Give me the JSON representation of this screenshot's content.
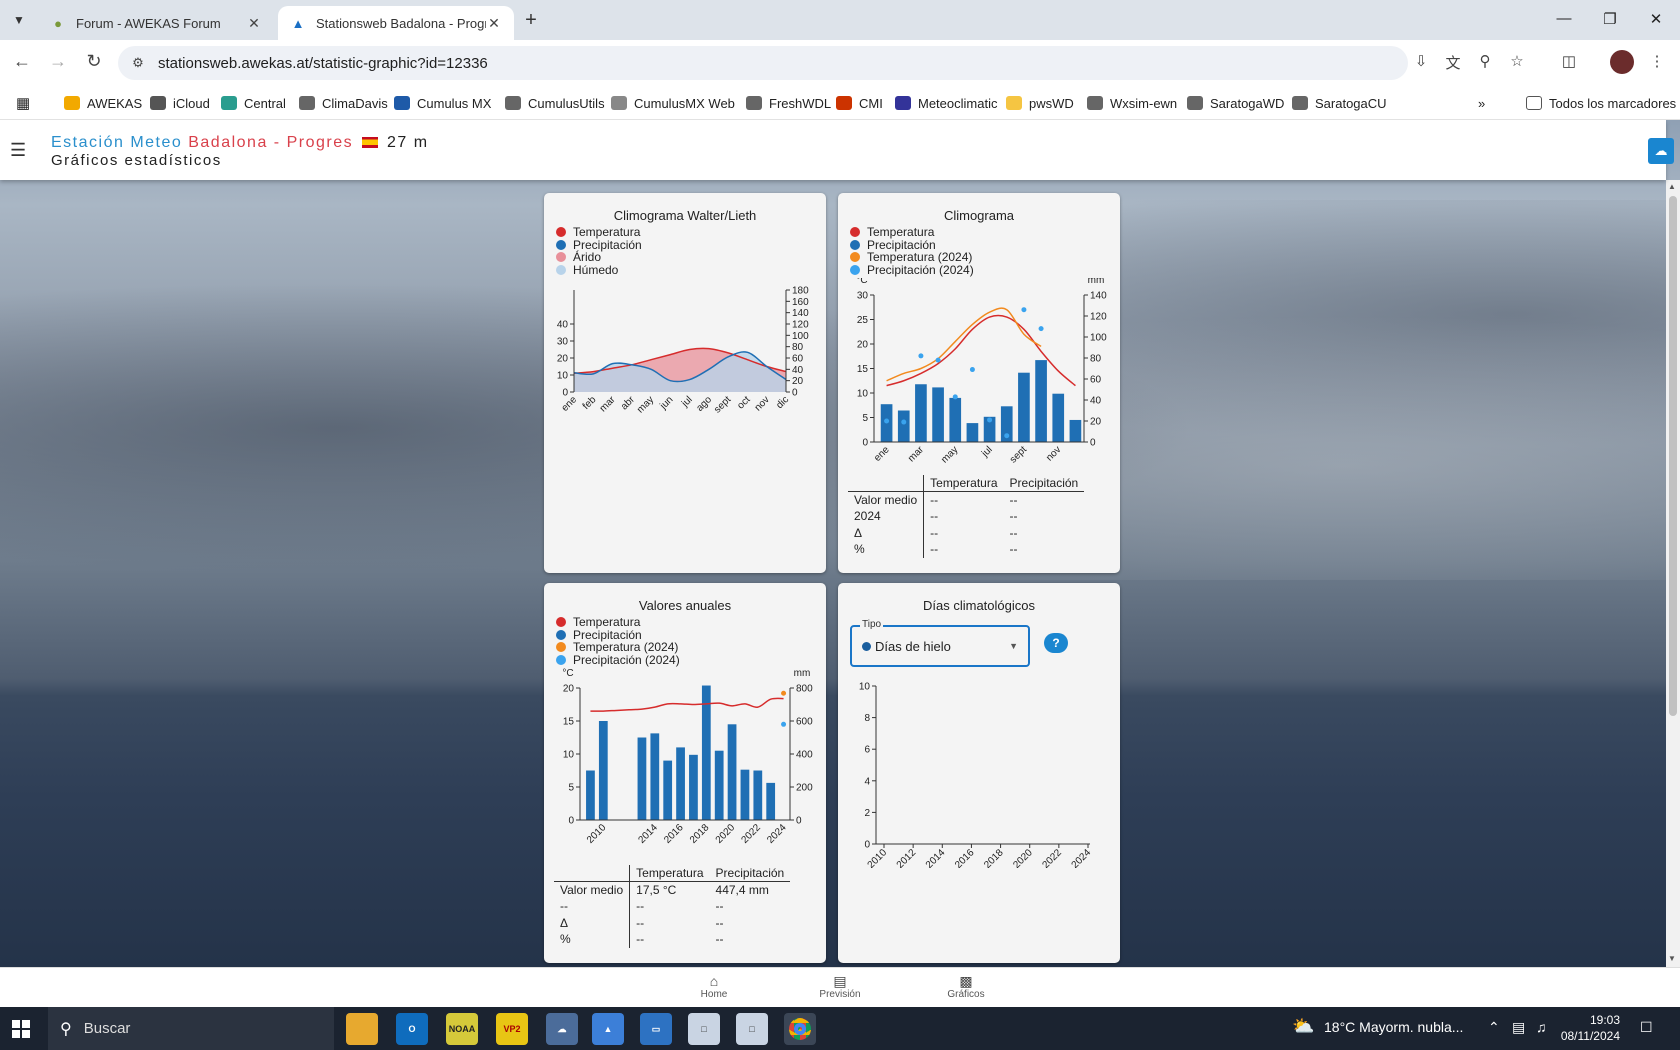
{
  "browser": {
    "tabs": [
      {
        "title": "Forum - AWEKAS Forum"
      },
      {
        "title": "Stationsweb Badalona - Progres"
      }
    ],
    "url": "stationsweb.awekas.at/statistic-graphic?id=12336",
    "bookmarks": [
      {
        "label": "AWEKAS",
        "color": "#f2a900"
      },
      {
        "label": "iCloud",
        "color": "#555555"
      },
      {
        "label": "Central",
        "color": "#2a9d8f"
      },
      {
        "label": "ClimaDavis",
        "color": "#666666"
      },
      {
        "label": "Cumulus MX",
        "color": "#1e5aa8"
      },
      {
        "label": "CumulusUtils",
        "color": "#666666"
      },
      {
        "label": "CumulusMX Web",
        "color": "#888888"
      },
      {
        "label": "FreshWDL",
        "color": "#666666"
      },
      {
        "label": "CMI",
        "color": "#cc3300"
      },
      {
        "label": "Meteoclimatic",
        "color": "#333399"
      },
      {
        "label": "pwsWD",
        "color": "#f5c542"
      },
      {
        "label": "Wxsim-ewn",
        "color": "#666666"
      },
      {
        "label": "SaratogaWD",
        "color": "#666666"
      },
      {
        "label": "SaratogaCU",
        "color": "#666666"
      }
    ],
    "all_bookmarks": "Todos los marcadores"
  },
  "site": {
    "station_part1": "Estación Meteo",
    "station_part2": "Badalona - Progres",
    "altitude": "27 m",
    "subtitle": "Gráficos estadísticos"
  },
  "colors": {
    "temperature": "#d62c2c",
    "precipitation": "#1f6fb4",
    "temperature_2024": "#f28a1e",
    "precipitation_2024": "#3aa3ee",
    "arid": "#e8909a",
    "humid": "#b8d3ea"
  },
  "cards": {
    "walter": {
      "title": "Climograma Walter/Lieth",
      "legend": [
        "Temperatura",
        "Precipitación",
        "Árido",
        "Húmedo"
      ]
    },
    "climograma": {
      "title": "Climograma",
      "legend": [
        "Temperatura",
        "Precipitación",
        "Temperatura (2024)",
        "Precipitación (2024)"
      ],
      "table": {
        "headers": [
          "Temperatura",
          "Precipitación"
        ],
        "rows": [
          {
            "label": "Valor medio",
            "temp": "--",
            "prec": "--"
          },
          {
            "label": "2024",
            "temp": "--",
            "prec": "--"
          },
          {
            "label": "Δ",
            "temp": "--",
            "prec": "--"
          },
          {
            "label": "%",
            "temp": "--",
            "prec": "--"
          }
        ]
      }
    },
    "anuales": {
      "title": "Valores anuales",
      "legend": [
        "Temperatura",
        "Precipitación",
        "Temperatura (2024)",
        "Precipitación (2024)"
      ],
      "table": {
        "headers": [
          "Temperatura",
          "Precipitación"
        ],
        "rows": [
          {
            "label": "Valor medio",
            "temp": "17,5 °C",
            "prec": "447,4 mm"
          },
          {
            "label": "--",
            "temp": "--",
            "prec": "--"
          },
          {
            "label": "Δ",
            "temp": "--",
            "prec": "--"
          },
          {
            "label": "%",
            "temp": "--",
            "prec": "--"
          }
        ]
      }
    },
    "dias": {
      "title": "Días climatológicos",
      "select_label": "Tipo",
      "select_value": "Días de hielo",
      "help": "?"
    }
  },
  "chart_data": [
    {
      "type": "area",
      "title": "Climograma Walter/Lieth",
      "categories": [
        "ene",
        "feb",
        "mar",
        "abr",
        "may",
        "jun",
        "jul",
        "ago",
        "sept",
        "oct",
        "nov",
        "dic"
      ],
      "y_left_ticks": [
        0,
        10,
        20,
        30,
        40
      ],
      "y_right_ticks": [
        0,
        20,
        40,
        60,
        80,
        100,
        120,
        140,
        160,
        180
      ],
      "series": [
        {
          "name": "Temperatura",
          "axis": "left",
          "values": [
            11,
            12,
            14,
            16,
            19,
            22,
            25,
            25.5,
            23,
            19,
            15,
            12
          ]
        },
        {
          "name": "Precipitación",
          "axis": "right",
          "values": [
            34,
            32,
            50,
            48,
            40,
            20,
            22,
            40,
            62,
            70,
            45,
            22
          ]
        }
      ]
    },
    {
      "type": "bar",
      "title": "Climograma",
      "categories": [
        "ene",
        "feb",
        "mar",
        "abr",
        "may",
        "jun",
        "jul",
        "ago",
        "sept",
        "oct",
        "nov",
        "dic"
      ],
      "x_tick_labels": [
        "ene",
        "mar",
        "may",
        "jul",
        "sept",
        "nov"
      ],
      "y_left_label": "°C",
      "y_left_range": [
        0,
        30
      ],
      "y_left_ticks": [
        0,
        5,
        10,
        15,
        20,
        25,
        30
      ],
      "y_right_label": "mm",
      "y_right_range": [
        0,
        140
      ],
      "y_right_ticks": [
        0,
        20,
        40,
        60,
        80,
        100,
        120,
        140
      ],
      "series": [
        {
          "name": "Precipitación",
          "axis": "right",
          "kind": "bar",
          "values": [
            36,
            30,
            55,
            52,
            42,
            18,
            24,
            34,
            66,
            78,
            46,
            21
          ]
        },
        {
          "name": "Temperatura",
          "axis": "left",
          "kind": "line",
          "values": [
            11.5,
            12.5,
            14,
            16,
            19,
            23,
            25.5,
            25.5,
            23,
            18.5,
            14.5,
            11.5
          ]
        },
        {
          "name": "Temperatura (2024)",
          "axis": "left",
          "kind": "line",
          "values": [
            12.5,
            14,
            15,
            17,
            20.5,
            24,
            26.5,
            27,
            22,
            19.5
          ]
        },
        {
          "name": "Precipitación (2024)",
          "axis": "right",
          "kind": "point",
          "values": [
            20,
            19,
            82,
            78,
            43,
            69,
            21,
            6,
            126,
            108
          ]
        }
      ]
    },
    {
      "type": "bar",
      "title": "Valores anuales",
      "categories": [
        "2009",
        "2010",
        "2011",
        "2012",
        "2013",
        "2014",
        "2015",
        "2016",
        "2017",
        "2018",
        "2019",
        "2020",
        "2021",
        "2022",
        "2023",
        "2024"
      ],
      "x_tick_labels": [
        "2010",
        "2014",
        "2016",
        "2018",
        "2020",
        "2022",
        "2024"
      ],
      "y_left_label": "°C",
      "y_left_range": [
        0,
        20
      ],
      "y_left_ticks": [
        0,
        5,
        10,
        15,
        20
      ],
      "y_right_label": "mm",
      "y_right_range": [
        0,
        800
      ],
      "y_right_ticks": [
        0,
        200,
        400,
        600,
        800
      ],
      "series": [
        {
          "name": "Precipitación",
          "axis": "right",
          "kind": "bar",
          "values": [
            300,
            600,
            null,
            null,
            500,
            525,
            360,
            440,
            395,
            815,
            420,
            580,
            305,
            300,
            225,
            null
          ]
        },
        {
          "name": "Temperatura",
          "axis": "left",
          "kind": "line",
          "values": [
            16.5,
            16.5,
            16.6,
            16.7,
            16.8,
            17.1,
            17.6,
            17.6,
            17.5,
            17.6,
            17.7,
            17.3,
            17.6,
            17.1,
            18.3,
            18.4
          ]
        },
        {
          "name": "Temperatura (2024)",
          "axis": "left",
          "kind": "point",
          "values": [
            null,
            null,
            null,
            null,
            null,
            null,
            null,
            null,
            null,
            null,
            null,
            null,
            null,
            null,
            null,
            19.2
          ]
        },
        {
          "name": "Precipitación (2024)",
          "axis": "right",
          "kind": "point",
          "values": [
            null,
            null,
            null,
            null,
            null,
            null,
            null,
            null,
            null,
            null,
            null,
            null,
            null,
            null,
            null,
            580
          ]
        }
      ]
    },
    {
      "type": "bar",
      "title": "Días climatológicos",
      "categories": [
        "2010",
        "2012",
        "2014",
        "2016",
        "2018",
        "2020",
        "2022",
        "2024"
      ],
      "y_range": [
        0,
        10
      ],
      "y_ticks": [
        0,
        2,
        4,
        6,
        8,
        10
      ],
      "series": []
    }
  ],
  "bottom_nav": [
    {
      "label": "Home",
      "icon": "home-icon"
    },
    {
      "label": "Previsión",
      "icon": "forecast-icon"
    },
    {
      "label": "Gráficos",
      "icon": "bar-chart-icon"
    }
  ],
  "taskbar": {
    "search": "Buscar",
    "weather": "18°C  Mayorm. nubla...",
    "time": "19:03",
    "date": "08/11/2024"
  }
}
